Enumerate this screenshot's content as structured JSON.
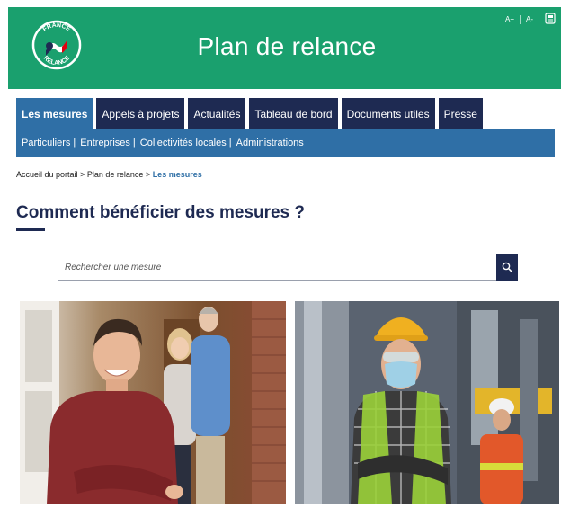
{
  "header": {
    "title": "Plan de relance",
    "logo_text": [
      "FRANCE",
      "RELANCE"
    ],
    "tools": {
      "decrease_font": "A-",
      "increase_font": "A+",
      "print_icon": "printer-icon"
    },
    "background": "#1aa06e"
  },
  "tabs": [
    {
      "label": "Les mesures",
      "active": true
    },
    {
      "label": "Appels à projets",
      "active": false
    },
    {
      "label": "Actualités",
      "active": false
    },
    {
      "label": "Tableau de bord",
      "active": false
    },
    {
      "label": "Documents utiles",
      "active": false
    },
    {
      "label": "Presse",
      "active": false
    }
  ],
  "subnav": [
    {
      "label": "Particuliers"
    },
    {
      "label": "Entreprises"
    },
    {
      "label": "Collectivités locales"
    },
    {
      "label": "Administrations"
    }
  ],
  "breadcrumb": {
    "items": [
      "Accueil du portail",
      "Plan de relance"
    ],
    "current": "Les mesures",
    "separator": ">"
  },
  "main": {
    "title": "Comment bénéficier des mesures ?",
    "search": {
      "placeholder": "Rechercher une mesure",
      "icon": "search-icon"
    },
    "cards": [
      {
        "image": "smiling young man in red sweater with older couple behind"
      },
      {
        "image": "industrial worker with hard hat, safety glasses and face mask"
      }
    ]
  },
  "colors": {
    "primary_dark": "#1e2a52",
    "secondary_blue": "#2f6fa6",
    "green": "#1aa06e"
  }
}
